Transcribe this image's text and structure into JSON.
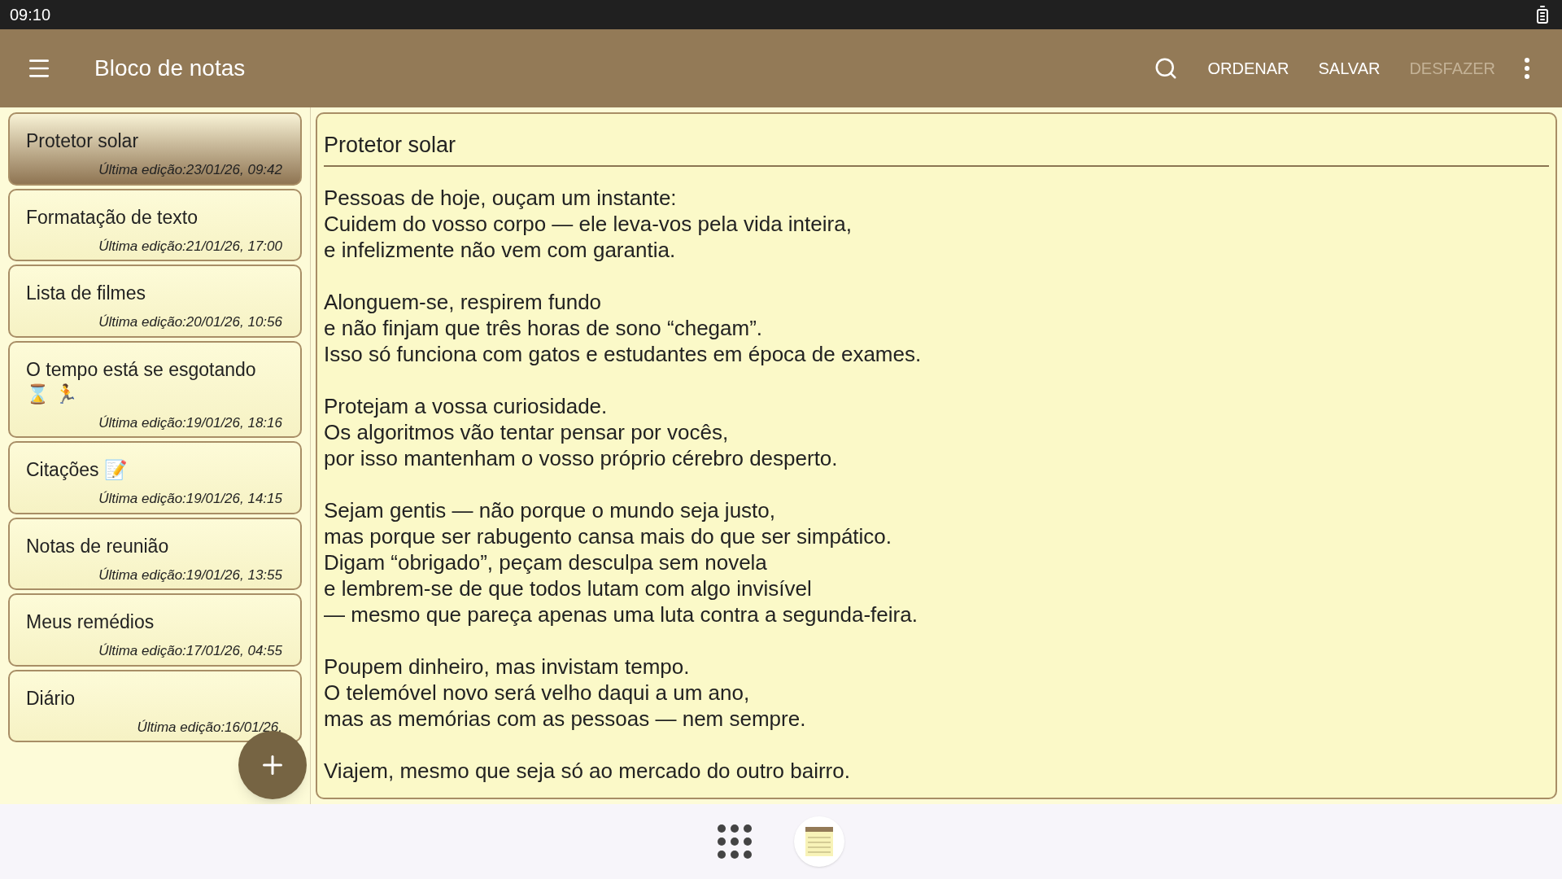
{
  "status_bar": {
    "time": "09:10"
  },
  "app_bar": {
    "title": "Bloco de notas",
    "actions": [
      {
        "kind": "search",
        "disabled": false
      },
      {
        "kind": "text",
        "label": "ORDENAR",
        "disabled": false
      },
      {
        "kind": "text",
        "label": "SALVAR",
        "disabled": false
      },
      {
        "kind": "text",
        "label": "DESFAZER",
        "disabled": true
      },
      {
        "kind": "more",
        "disabled": false
      }
    ]
  },
  "notes": [
    {
      "title": "Protetor solar",
      "edited": "Última edição:23/01/26, 09:42",
      "selected": true
    },
    {
      "title": "Formatação de texto",
      "edited": "Última edição:21/01/26, 17:00",
      "selected": false
    },
    {
      "title": "Lista de filmes",
      "edited": "Última edição:20/01/26, 10:56",
      "selected": false
    },
    {
      "title": "O tempo está se esgotando ⌛ 🏃",
      "edited": "Última edição:19/01/26, 18:16",
      "selected": false
    },
    {
      "title": "Citações 📝",
      "edited": "Última edição:19/01/26, 14:15",
      "selected": false
    },
    {
      "title": "Notas de reunião",
      "edited": "Última edição:19/01/26, 13:55",
      "selected": false
    },
    {
      "title": "Meus remédios",
      "edited": "Última edição:17/01/26, 04:55",
      "selected": false
    },
    {
      "title": "Diário",
      "edited": "Última edição:16/01/26,",
      "selected": false
    }
  ],
  "editor": {
    "title": "Protetor solar",
    "paragraphs": [
      [
        "Pessoas de hoje, ouçam um instante:",
        "Cuidem do vosso corpo — ele leva-vos pela vida inteira,",
        "e infelizmente não vem com garantia."
      ],
      [
        "Alonguem-se, respirem fundo",
        "e não finjam que três horas de sono “chegam”.",
        "Isso só funciona com gatos e estudantes em época de exames."
      ],
      [
        "Protejam a vossa curiosidade.",
        "Os algoritmos vão tentar pensar por vocês,",
        "por isso mantenham o vosso próprio cérebro desperto."
      ],
      [
        "Sejam gentis — não porque o mundo seja justo,",
        "mas porque ser rabugento cansa mais do que ser simpático.",
        "Digam “obrigado”, peçam desculpa sem novela",
        "e lembrem-se de que todos lutam com algo invisível",
        "— mesmo que pareça apenas uma luta contra a segunda-feira."
      ],
      [
        "Poupem dinheiro, mas invistam tempo.",
        "O telemóvel novo será velho daqui a um ano,",
        "mas as memórias com as pessoas — nem sempre."
      ],
      [
        "Viajem, mesmo que seja só ao mercado do outro bairro."
      ]
    ]
  }
}
